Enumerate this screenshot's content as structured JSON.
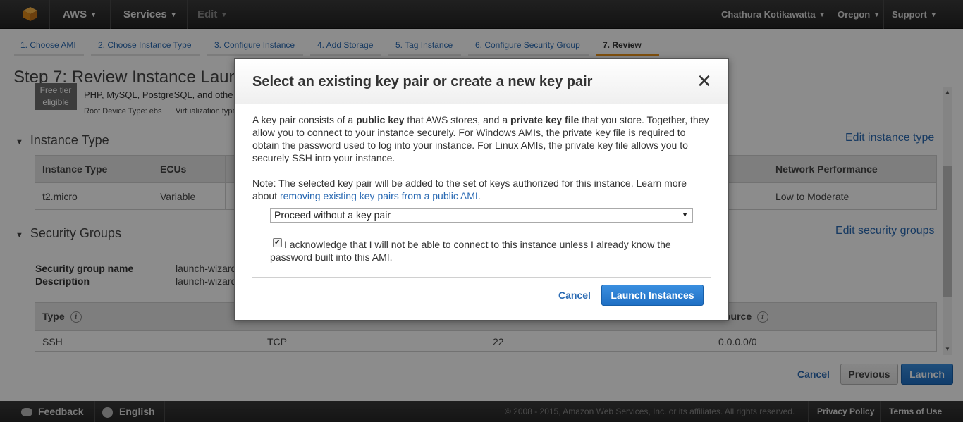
{
  "topnav": {
    "brand": "AWS",
    "services": "Services",
    "edit": "Edit",
    "user": "Chathura Kotikawatta",
    "region": "Oregon",
    "support": "Support"
  },
  "steps": [
    {
      "label": "1. Choose AMI"
    },
    {
      "label": "2. Choose Instance Type"
    },
    {
      "label": "3. Configure Instance"
    },
    {
      "label": "4. Add Storage"
    },
    {
      "label": "5. Tag Instance"
    },
    {
      "label": "6. Configure Security Group"
    },
    {
      "label": "7. Review"
    }
  ],
  "page": {
    "title": "Step 7: Review Instance Laun",
    "freetier_line1": "Free tier",
    "freetier_line2": "eligible",
    "ami_desc": "PHP, MySQL, PostgreSQL, and othe",
    "root_device": "Root Device Type: ebs",
    "virtualization": "Virtualization type"
  },
  "instance_type": {
    "title": "Instance Type",
    "edit": "Edit instance type",
    "headers": [
      "Instance Type",
      "ECUs",
      "Network Performance"
    ],
    "row": [
      "t2.micro",
      "Variable",
      "Low to Moderate"
    ]
  },
  "security_groups": {
    "title": "Security Groups",
    "edit": "Edit security groups",
    "name_label": "Security group name",
    "desc_label": "Description",
    "name_value": "launch-wizard",
    "desc_value": "launch-wizard",
    "headers": [
      "Type",
      "ource"
    ],
    "row": [
      "SSH",
      "TCP",
      "22",
      "0.0.0.0/0"
    ]
  },
  "bottom": {
    "cancel": "Cancel",
    "previous": "Previous",
    "launch": "Launch"
  },
  "footer": {
    "feedback": "Feedback",
    "language": "English",
    "copyright": "© 2008 - 2015, Amazon Web Services, Inc. or its affiliates. All rights reserved.",
    "privacy": "Privacy Policy",
    "terms": "Terms of Use"
  },
  "modal": {
    "title": "Select an existing key pair or create a new key pair",
    "close": "✕",
    "body_1": "A key pair consists of a ",
    "body_public": "public key",
    "body_2": " that AWS stores, and a ",
    "body_private": "private key file",
    "body_3": " that you store. Together, they allow you to connect to your instance securely. For Windows AMIs, the private key file is required to obtain the password used to log into your instance. For Linux AMIs, the private key file allows you to securely SSH into your instance.",
    "note_text": "Note: The selected key pair will be added to the set of keys authorized for this instance. Learn more about ",
    "note_link": "removing existing key pairs from a public AMI",
    "note_end": ".",
    "select_value": "Proceed without a key pair",
    "ack": "I acknowledge that I will not be able to connect to this instance unless I already know the password built into this AMI.",
    "cancel": "Cancel",
    "launch": "Launch Instances"
  }
}
